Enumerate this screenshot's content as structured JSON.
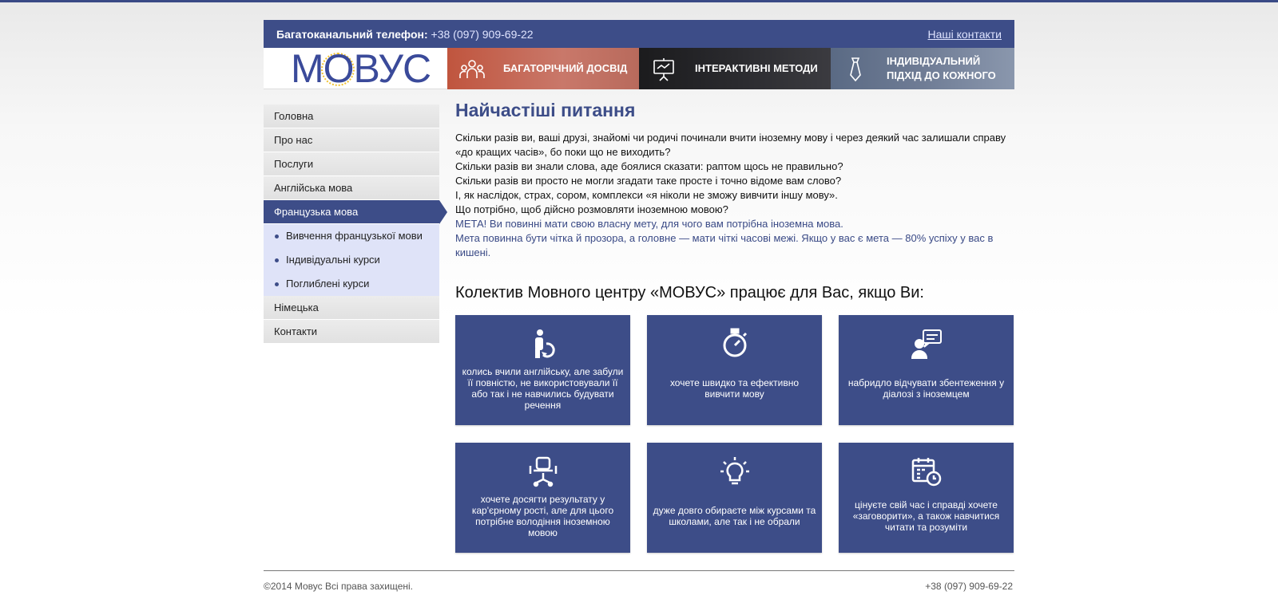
{
  "topbar": {
    "phone_label": "Багатоканальний телефон:",
    "phone_number": "+38 (097) 909-69-22",
    "contacts_link": "Наші контакти"
  },
  "logo": {
    "text": "МОВУС"
  },
  "features": [
    {
      "icon": "people-icon",
      "label": "БАГАТОРІЧНИЙ ДОСВІД"
    },
    {
      "icon": "presentation-icon",
      "label": "ІНТЕРАКТИВНІ МЕТОДИ"
    },
    {
      "icon": "tie-icon",
      "label_line1": "ІНДИВІДУАЛЬНИЙ",
      "label_line2": "ПІДХІД ДО КОЖНОГО"
    }
  ],
  "sidebar": {
    "items": [
      {
        "label": "Головна"
      },
      {
        "label": "Про нас"
      },
      {
        "label": "Послуги"
      },
      {
        "label": "Англійська мова"
      },
      {
        "label": "Французька мова",
        "active": true
      },
      {
        "label": "Німецька"
      },
      {
        "label": "Контакти"
      }
    ],
    "subitems": [
      {
        "label": "Вивчення французької мови"
      },
      {
        "label": "Індивідуальні курси"
      },
      {
        "label": "Поглиблені курси"
      }
    ]
  },
  "main": {
    "title": "Найчастіші питання",
    "paragraph": [
      "Скільки разів ви, ваші друзі, знайомі чи родичі починали вчити іноземну мову і через деякий час залишали справу «до кращих часів», бо поки що не виходить?",
      "Скільки разів ви знали слова, аде боялися сказати: раптом щось не правильно?",
      "Скільки разів ви просто не могли згадати таке просте і точно відоме вам слово?",
      "І, як наслідок, страх, сором, комплекси «я ніколи не зможу вивчити іншу мову».",
      "Що потрібно, щоб дійсно розмовляти іноземною мовою?",
      "МЕТА! Ви повинні мати свою власну мету, для чого вам потрібна іноземна мова.",
      "Мета повинна бути чітка й прозора, а головне — мати чіткі часові межі. Якщо у вас є мета — 80% успіху у вас в кишені."
    ],
    "subtitle": "Колектив Мовного центру «МОВУС» працює для Вас, якщо Ви:",
    "accent_color": "#3d4d88"
  },
  "cards": [
    {
      "icon": "person-refresh-icon",
      "text": "колись вчили англійську, але забули її повністю, не використовували її або так і не навчились будувати речення"
    },
    {
      "icon": "stopwatch-icon",
      "text": "хочете швидко та ефективно вивчити мову"
    },
    {
      "icon": "dialog-icon",
      "text": "набридло відчувати збентеження у діалозі з іноземцем"
    },
    {
      "icon": "office-chair-icon",
      "text": "хочете досягти результату у кар'єрному рості, але для цього потрібне володіння іноземною мовою"
    },
    {
      "icon": "lightbulb-icon",
      "text": "дуже довго обираєте між курсами та школами, але так і не обрали"
    },
    {
      "icon": "calendar-clock-icon",
      "text": "цінуєте свій час і справді хочете «заговорити», а також навчитися читати та розуміти"
    }
  ],
  "footer": {
    "copyright": "©2014 Мовус Всі права захищені.",
    "phone": "+38 (097) 909-69-22"
  }
}
